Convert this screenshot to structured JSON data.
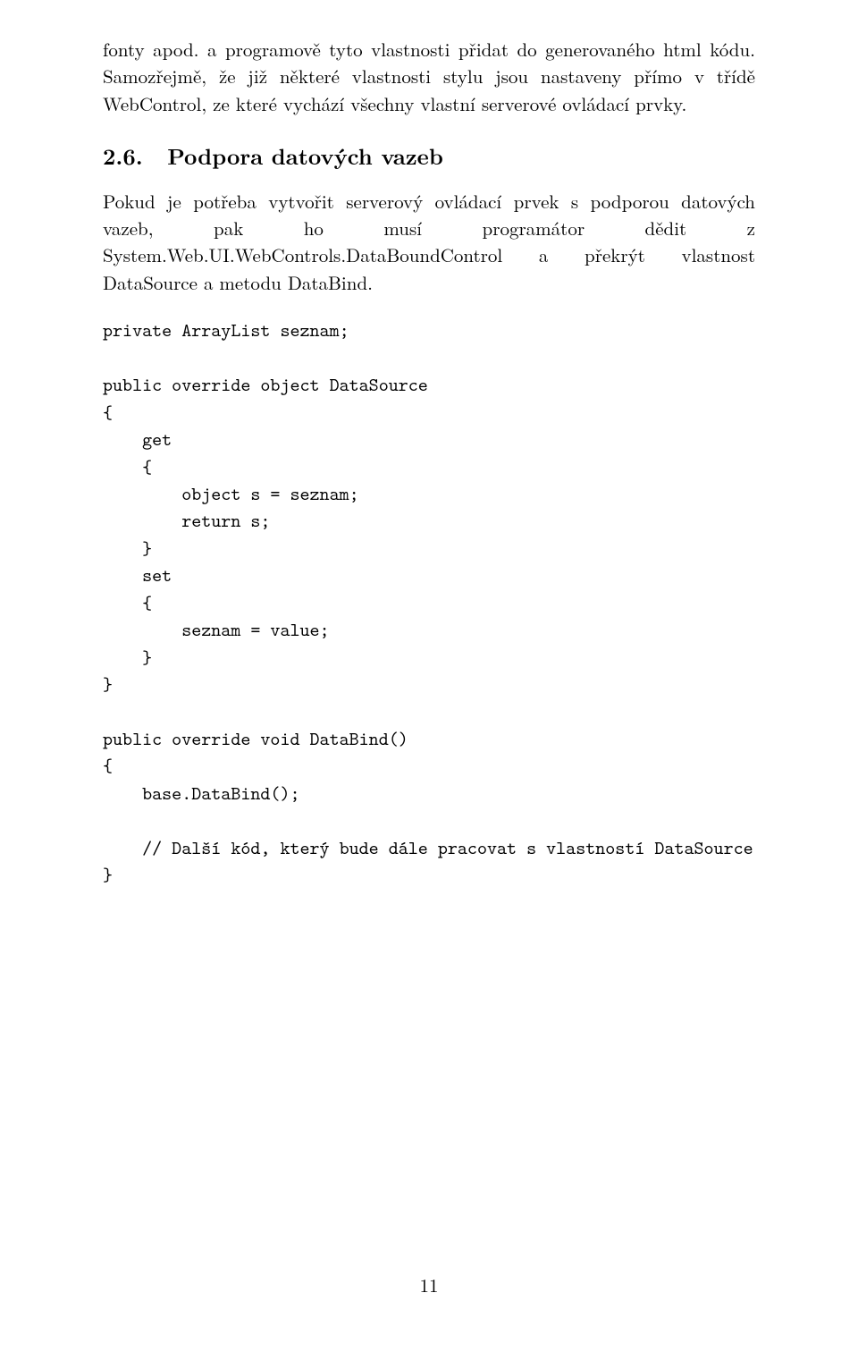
{
  "para1": "fonty apod. a programově tyto vlastnosti přidat do generovaného html kódu. Samozřejmě, že již některé vlastnosti stylu jsou nastaveny přímo v třídě WebControl, ze které vychází všechny vlastní serverové ovládací prvky.",
  "section": {
    "number": "2.6.",
    "title": "Podpora datových vazeb"
  },
  "para2": "Pokud je potřeba vytvořit serverový ovládací prvek s podporou datových vazeb, pak ho musí programátor dědit z System.Web.UI.WebControls.DataBoundControl a překrýt vlastnost DataSource a metodu DataBind.",
  "code": "private ArrayList seznam;\n\npublic override object DataSource\n{\n    get\n    {\n        object s = seznam;\n        return s;\n    }\n    set\n    {\n        seznam = value;\n    }\n}\n\npublic override void DataBind()\n{\n    base.DataBind();\n\n    // Další kód, který bude dále pracovat s vlastností DataSource\n}",
  "pageNumber": "11"
}
